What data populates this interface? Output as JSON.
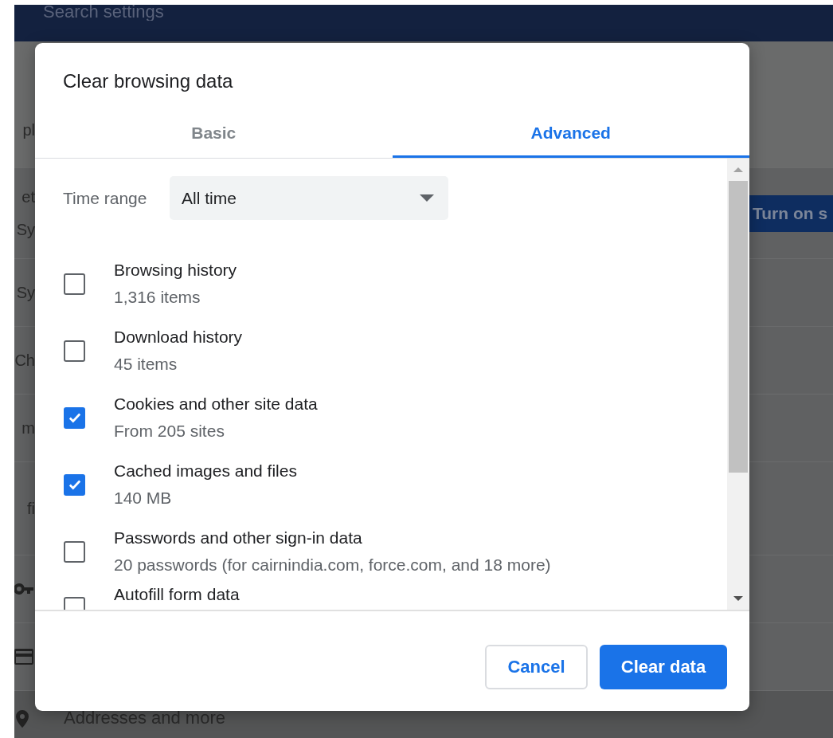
{
  "background": {
    "search": {
      "placeholder": "Search settings"
    },
    "rows": [
      {
        "label": "pl"
      },
      {
        "label": "et",
        "sublabel": "Sy",
        "button": "Turn on s"
      },
      {
        "label": "Sy"
      },
      {
        "label": "Ch"
      },
      {
        "label": "m"
      },
      {
        "label": "fi"
      }
    ],
    "addresses_row": "Addresses and more"
  },
  "dialog": {
    "title": "Clear browsing data",
    "tabs": [
      {
        "label": "Basic",
        "selected": false
      },
      {
        "label": "Advanced",
        "selected": true
      }
    ],
    "time_range": {
      "label": "Time range",
      "value": "All time"
    },
    "items": [
      {
        "title": "Browsing history",
        "detail": "1,316 items",
        "checked": false
      },
      {
        "title": "Download history",
        "detail": "45 items",
        "checked": false
      },
      {
        "title": "Cookies and other site data",
        "detail": "From 205 sites",
        "checked": true
      },
      {
        "title": "Cached images and files",
        "detail": "140 MB",
        "checked": true
      },
      {
        "title": "Passwords and other sign-in data",
        "detail": "20 passwords (for cairnindia.com, force.com, and 18 more)",
        "checked": false
      },
      {
        "title": "Autofill form data",
        "checked": false
      }
    ],
    "buttons": [
      {
        "label": "Cancel",
        "kind": "secondary"
      },
      {
        "label": "Clear data",
        "kind": "primary"
      }
    ]
  }
}
